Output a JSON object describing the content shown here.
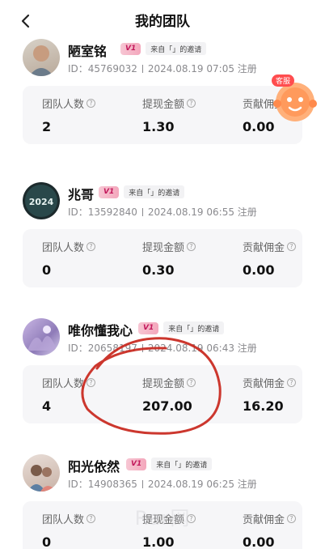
{
  "header": {
    "title": "我的团队"
  },
  "service": {
    "tag": "客服"
  },
  "labels": {
    "team_count": "团队人数",
    "withdraw": "提现金额",
    "commission": "贡献佣金",
    "invite": "来自「」的邀请",
    "register": "注册",
    "level": "V1"
  },
  "members": [
    {
      "name": "陋室铭",
      "id": "ID：45769032",
      "time": "2024.08.19 07:05",
      "team_count": "2",
      "withdraw": "1.30",
      "commission": "0.00"
    },
    {
      "name": "兆哥",
      "id": "ID：13592840",
      "time": "2024.08.19 06:55",
      "team_count": "0",
      "withdraw": "0.30",
      "commission": "0.00",
      "avatar_text": "2024"
    },
    {
      "name": "唯你懂我心",
      "id": "ID：20658197",
      "time": "2024.08.19 06:43",
      "team_count": "4",
      "withdraw": "207.00",
      "commission": "16.20"
    },
    {
      "name": "阳光依然",
      "id": "ID：14908365",
      "time": "2024.08.19 06:25",
      "team_count": "0",
      "withdraw": "1.00",
      "commission": "0.00"
    }
  ],
  "watermark": "Rar网"
}
